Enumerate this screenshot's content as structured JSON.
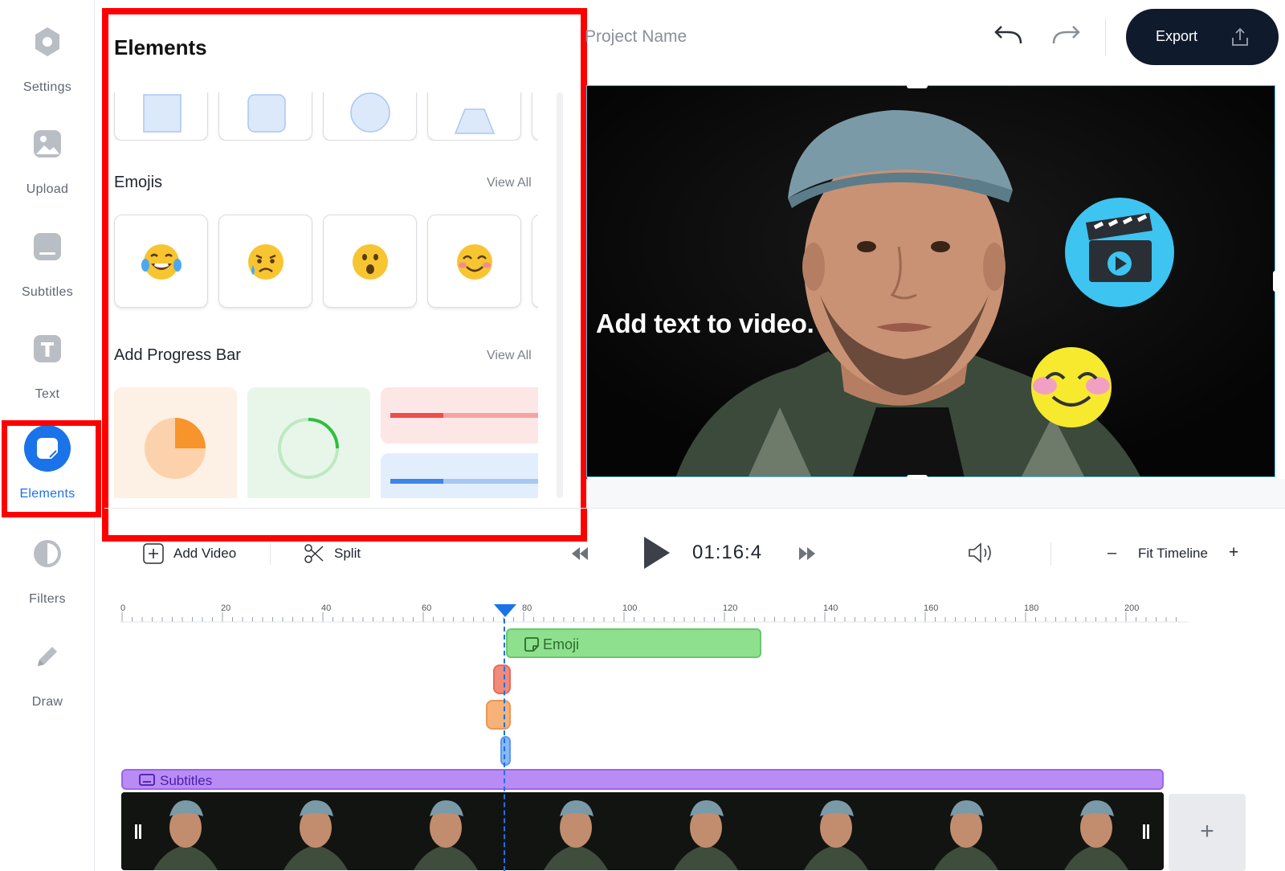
{
  "sidebar": {
    "items": [
      {
        "label": "Settings",
        "icon": "settings-icon"
      },
      {
        "label": "Upload",
        "icon": "upload-icon"
      },
      {
        "label": "Subtitles",
        "icon": "subtitles-icon"
      },
      {
        "label": "Text",
        "icon": "text-icon"
      },
      {
        "label": "Elements",
        "icon": "elements-icon",
        "active": true
      },
      {
        "label": "Filters",
        "icon": "filters-icon"
      },
      {
        "label": "Draw",
        "icon": "draw-icon"
      }
    ],
    "active_color": "#1a73e8"
  },
  "panel": {
    "title": "Elements",
    "shapes": [
      "square",
      "rounded-square",
      "circle",
      "triangle"
    ],
    "emojis_title": "Emojis",
    "emojis_view_all": "View All",
    "emojis": [
      "😂",
      "😥",
      "😮",
      "😊"
    ],
    "progress_title": "Add Progress Bar",
    "progress_view_all": "View All",
    "progress_bars": [
      "pie-progress",
      "ring-progress",
      "red-bar-progress",
      "blue-bar-progress"
    ]
  },
  "topbar": {
    "project_name": "Project Name",
    "export_label": "Export"
  },
  "preview": {
    "overlay_text": "Add text to video."
  },
  "controls": {
    "add_video_label": "Add Video",
    "split_label": "Split",
    "time": "01:16:4",
    "fit_timeline_label": "Fit Timeline",
    "zoom_out_label": "–",
    "zoom_in_label": "+"
  },
  "timeline": {
    "ruler_labels": [
      "0",
      "20",
      "40",
      "60",
      "80",
      "100",
      "120",
      "140",
      "160",
      "180",
      "200"
    ],
    "emoji_track_label": "Emoji",
    "subtitles_track_label": "Subtitles",
    "add_clip_label": "+"
  },
  "colors": {
    "highlight": "#ff0000",
    "export_bg": "#101a2d",
    "emoji_track": "#8ee08e",
    "subtitles_track": "#b98cf5",
    "playhead": "#1a73e8"
  }
}
